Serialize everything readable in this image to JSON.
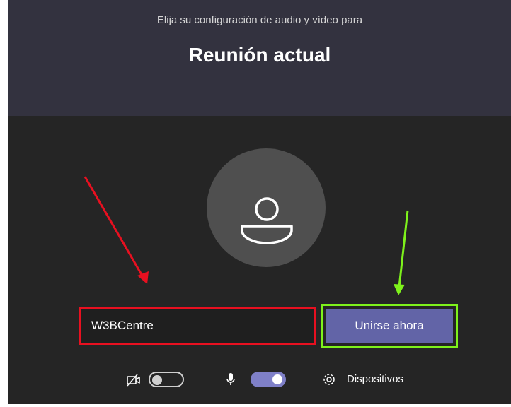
{
  "dialog": {
    "subtitle": "Elija su configuración de audio y vídeo para",
    "title": "Reunión actual"
  },
  "name_input": {
    "value": "W3BCentre"
  },
  "join_button": {
    "label": "Unirse ahora"
  },
  "controls": {
    "camera_toggle": {
      "state": "off",
      "icon": "camera-off-icon"
    },
    "mic_toggle": {
      "state": "on",
      "icon": "microphone-icon"
    },
    "devices": {
      "label": "Dispositivos",
      "icon": "gear-icon"
    }
  },
  "annotations": [
    {
      "name": "red-arrow",
      "color": "#e81020",
      "points_to": "name-input"
    },
    {
      "name": "green-arrow",
      "color": "#7ef21b",
      "points_to": "join-button"
    }
  ],
  "colors": {
    "header_bg": "#33323f",
    "body_bg": "#252525",
    "accent": "#6264a7",
    "highlight_red": "#e81020",
    "highlight_green": "#7ef21b"
  }
}
